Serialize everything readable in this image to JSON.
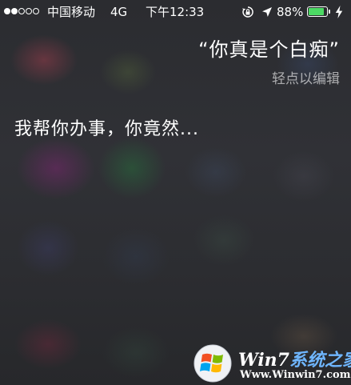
{
  "status_bar": {
    "signal_bars": 2,
    "signal_total": 5,
    "carrier": "中国移动",
    "network": "4G",
    "time": "下午12:33",
    "battery_percent": "88%",
    "battery_level": 0.88,
    "battery_color": "#4cd964",
    "icons": [
      "rotation-lock-icon",
      "location-arrow-icon",
      "battery-icon",
      "charging-bolt-icon"
    ]
  },
  "siri": {
    "user_query": "“你真是个白痴”",
    "edit_hint": "轻点以编辑",
    "reply": "我帮你办事，你竟然..."
  },
  "watermark": {
    "brand_part1": "Win7",
    "brand_part2": "系统之家",
    "url": "Www.Winwin7.com",
    "logo": "windows-logo"
  }
}
